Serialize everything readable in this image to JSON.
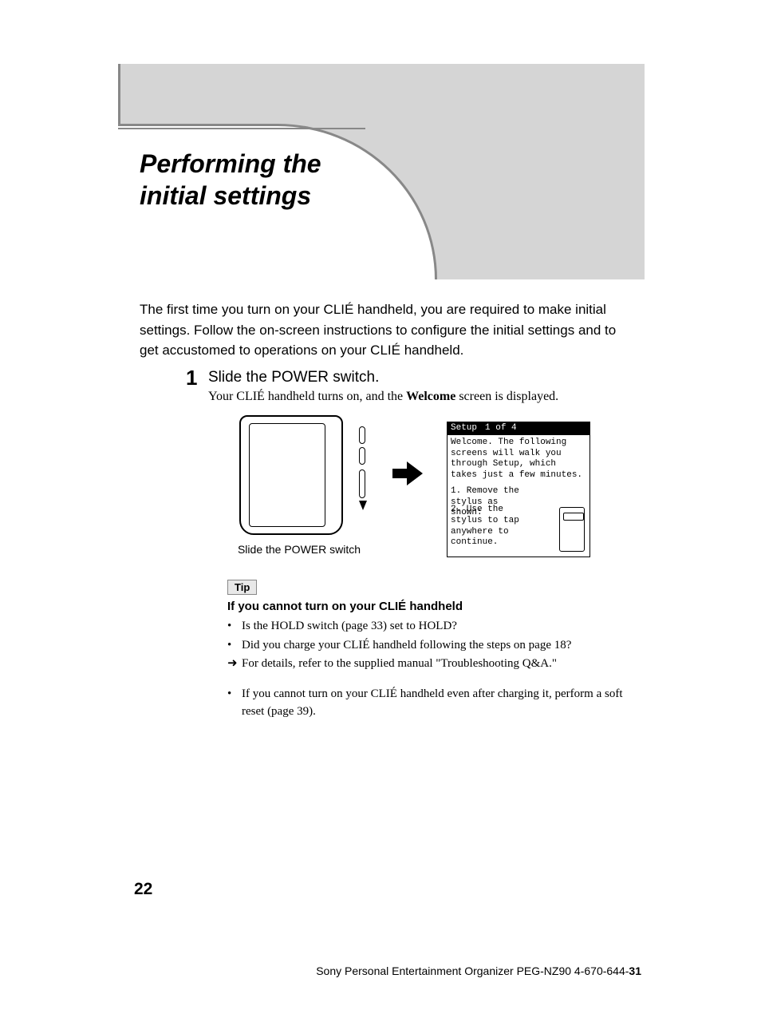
{
  "title_line1": "Performing the",
  "title_line2": "initial settings",
  "intro": "The first time you turn on your CLIÉ handheld, you are required to make initial settings. Follow the on-screen instructions to configure the initial settings and to get accustomed to operations on your CLIÉ handheld.",
  "step": {
    "number": "1",
    "heading": "Slide the POWER switch.",
    "body_pre": "Your CLIÉ handheld turns on, and the ",
    "body_bold": "Welcome",
    "body_post": " screen is displayed."
  },
  "device_caption": "Slide the POWER switch",
  "setup_screen": {
    "title_left": "Setup",
    "title_right": "1 of 4",
    "welcome": "Welcome. The following screens will walk you through Setup, which takes just a few minutes.",
    "item1": "1. Remove the stylus as shown:",
    "item2": "2. Use the stylus to tap anywhere to continue."
  },
  "tip": {
    "label": "Tip",
    "heading": "If you cannot turn on your CLIÉ handheld",
    "items": [
      {
        "bullet": "•",
        "text": "Is the HOLD switch (page 33) set to HOLD?"
      },
      {
        "bullet": "•",
        "text": "Did you charge your CLIÉ handheld following the steps on page 18?"
      },
      {
        "bullet": "➜",
        "text": "For details, refer to the supplied manual \"Troubleshooting Q&A.\""
      }
    ],
    "after": {
      "bullet": "•",
      "text": "If you cannot turn on your CLIÉ handheld even after charging it, perform a soft reset (page 39)."
    }
  },
  "page_number": "22",
  "footer": {
    "pre": "Sony Personal Entertainment Organizer  PEG-NZ90  4-670-644-",
    "bold": "31"
  }
}
